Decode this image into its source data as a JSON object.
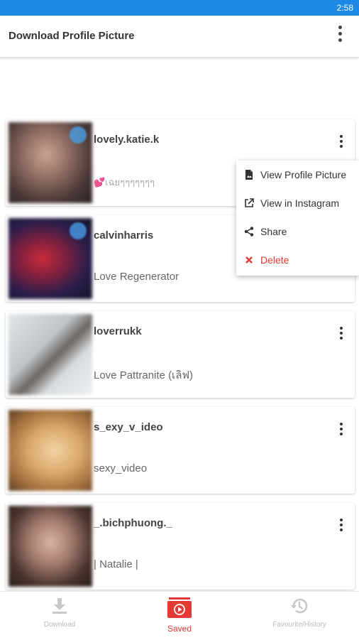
{
  "status_bar": {
    "time": "2:58"
  },
  "app_bar": {
    "title": "Download Profile Picture",
    "overflow_icon": "more-vert-icon"
  },
  "profiles": [
    {
      "username": "lovely.katie.k",
      "full_name": "💕เฉยๆๆๆๆๆๆๆ",
      "has_badge": true
    },
    {
      "username": "calvinharris",
      "full_name": "Love Regenerator",
      "has_badge": true
    },
    {
      "username": "loverrukk",
      "full_name": "Love Pattranite (เลิฟ)",
      "has_badge": false
    },
    {
      "username": "s_exy_v_ideo",
      "full_name": "sexy_video",
      "has_badge": false
    },
    {
      "username": "_.bichphuong._",
      "full_name": "| Natalie |",
      "has_badge": false
    }
  ],
  "context_menu": {
    "items": [
      {
        "label": "View Profile Picture",
        "icon": "image-file-icon"
      },
      {
        "label": "View in Instagram",
        "icon": "external-link-icon"
      },
      {
        "label": "Share",
        "icon": "share-icon"
      },
      {
        "label": "Delete",
        "icon": "close-icon"
      }
    ]
  },
  "bottom_nav": {
    "tabs": [
      {
        "label": "Download",
        "icon": "download-icon",
        "active": false
      },
      {
        "label": "Saved",
        "icon": "video-play-icon",
        "active": true
      },
      {
        "label": "Favourite/History",
        "icon": "history-icon",
        "active": false
      }
    ]
  },
  "colors": {
    "status_bar": "#1e88e5",
    "accent": "#e53935",
    "badge": "#4aa3f0"
  }
}
